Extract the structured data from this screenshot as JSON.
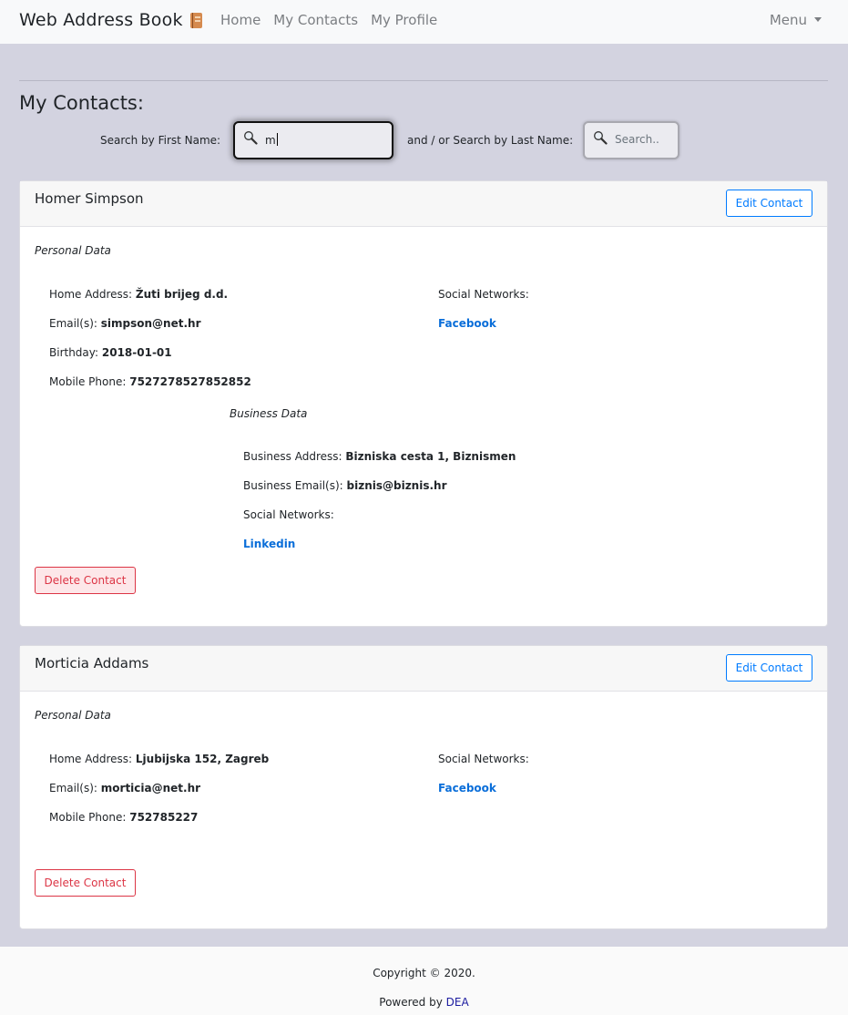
{
  "nav": {
    "brand": "Web Address Book",
    "links": [
      "Home",
      "My Contacts",
      "My Profile"
    ],
    "menu": "Menu"
  },
  "page": {
    "title": "My Contacts:"
  },
  "search": {
    "first_label": "Search by First Name:",
    "first_value": "m",
    "last_label": "and / or Search by Last Name:",
    "last_placeholder": "Search.."
  },
  "contacts": [
    {
      "name": "Homer Simpson",
      "edit_label": "Edit Contact",
      "personal_title": "Personal Data",
      "home_address_label": "Home Address",
      "home_address": "Žuti brijeg d.d.",
      "email_label": "Email(s)",
      "email": "simpson@net.hr",
      "birthday_label": "Birthday",
      "birthday": "2018-01-01",
      "mobile_label": "Mobile Phone",
      "mobile": "7527278527852852",
      "social_label": "Social Networks:",
      "social_link": "Facebook",
      "business_title": "Business Data",
      "business_address_label": "Business Address",
      "business_address": "Bizniska cesta 1, Biznismen",
      "business_email_label": "Business Email(s)",
      "business_email": "biznis@biznis.hr",
      "business_social_label": "Social Networks:",
      "business_social_link": "Linkedin",
      "delete_label": "Delete Contact"
    },
    {
      "name": "Morticia Addams",
      "edit_label": "Edit Contact",
      "personal_title": "Personal Data",
      "home_address_label": "Home Address",
      "home_address": "Ljubijska 152, Zagreb",
      "email_label": "Email(s)",
      "email": "morticia@net.hr",
      "mobile_label": "Mobile Phone",
      "mobile": "752785227",
      "social_label": "Social Networks:",
      "social_link": "Facebook",
      "delete_label": "Delete Contact"
    }
  ],
  "footer": {
    "copyright": "Copyright © 2020.",
    "powered_prefix": "Powered by",
    "powered_link": "DEA"
  }
}
